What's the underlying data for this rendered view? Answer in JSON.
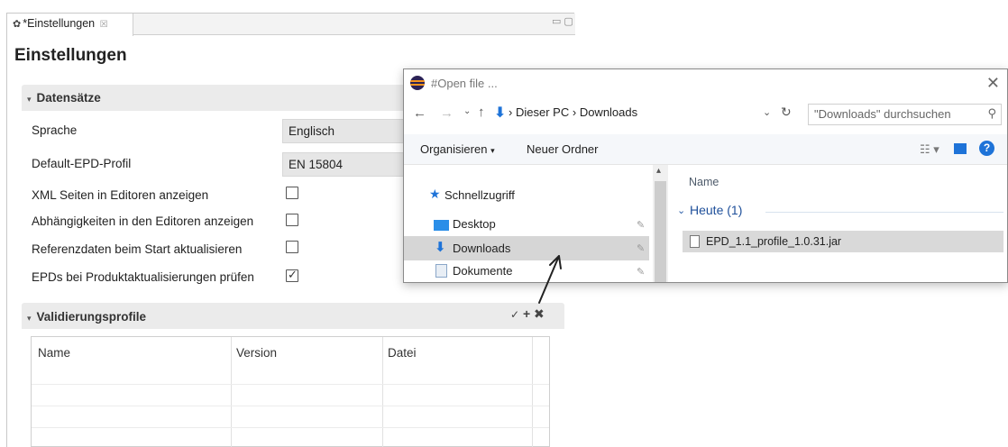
{
  "editor": {
    "tab_label": "*Einstellungen",
    "tab_close": "☒",
    "page_title": "Einstellungen"
  },
  "datensaetze": {
    "title": "Datensätze",
    "rows": [
      {
        "label": "Sprache",
        "value": "Englisch"
      },
      {
        "label": "Default-EPD-Profil",
        "value": "EN 15804"
      }
    ],
    "checkboxes": [
      {
        "label": "XML Seiten in Editoren anzeigen",
        "checked": false
      },
      {
        "label": "Abhängigkeiten in den Editoren anzeigen",
        "checked": false
      },
      {
        "label": "Referenzdaten beim Start aktualisieren",
        "checked": false
      },
      {
        "label": "EPDs bei Produktaktualisierungen prüfen",
        "checked": true
      }
    ]
  },
  "validierung": {
    "title": "Validierungsprofile",
    "columns": [
      "Name",
      "Version",
      "Datei"
    ]
  },
  "dialog": {
    "title": "#Open file ...",
    "breadcrumb": [
      "Dieser PC",
      "Downloads"
    ],
    "search_placeholder": "\"Downloads\" durchsuchen",
    "organize": "Organisieren",
    "new_folder": "Neuer Ordner",
    "nav_items": [
      {
        "label": "Schnellzugriff",
        "icon": "star-icon",
        "selected": false
      },
      {
        "label": "Desktop",
        "icon": "desktop-folder-icon",
        "selected": false
      },
      {
        "label": "Downloads",
        "icon": "download-arrow-icon",
        "selected": true
      },
      {
        "label": "Dokumente",
        "icon": "document-icon",
        "selected": false
      }
    ],
    "column_header": "Name",
    "group_label": "Heute (1)",
    "file_name": "EPD_1.1_profile_1.0.31.jar"
  },
  "colors": {
    "accent": "#0a64c8",
    "selected": "#d6d6d6",
    "section_bar": "#ebebeb"
  }
}
